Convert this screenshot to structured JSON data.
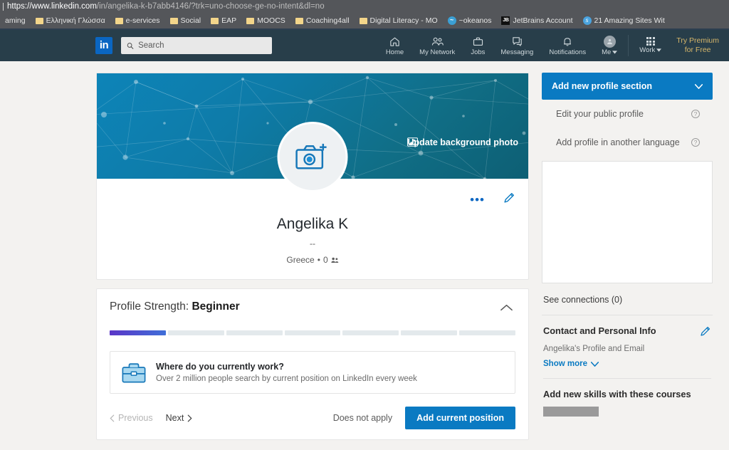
{
  "browser": {
    "url_strong": "https://www.linkedin.com",
    "url_dim": "/in/angelika-k-b7abb4146/?trk=uno-choose-ge-no-intent&dl=no",
    "bookmarks": [
      {
        "label": "aming",
        "icon": "none"
      },
      {
        "label": "Ελληνική Γλώσσα",
        "icon": "folder-icon"
      },
      {
        "label": "e-services",
        "icon": "folder-icon"
      },
      {
        "label": "Social",
        "icon": "folder-icon"
      },
      {
        "label": "EAP",
        "icon": "folder-icon"
      },
      {
        "label": "MOOCS",
        "icon": "folder-icon"
      },
      {
        "label": "Coaching4all",
        "icon": "folder-icon"
      },
      {
        "label": "Digital Literacy - MO",
        "icon": "folder-icon"
      },
      {
        "label": "~okeanos",
        "icon": "wave-icon"
      },
      {
        "label": "JetBrains Account",
        "icon": "jetbrains-icon"
      },
      {
        "label": "21 Amazing Sites Wit",
        "icon": "circle-icon"
      }
    ]
  },
  "nav": {
    "logo": "in",
    "search_placeholder": "Search",
    "items": [
      {
        "label": "Home",
        "icon": "home-icon"
      },
      {
        "label": "My Network",
        "icon": "people-icon"
      },
      {
        "label": "Jobs",
        "icon": "briefcase-icon"
      },
      {
        "label": "Messaging",
        "icon": "message-icon"
      },
      {
        "label": "Notifications",
        "icon": "bell-icon"
      }
    ],
    "me_label": "Me",
    "work_label": "Work",
    "premium_line1": "Try Premium",
    "premium_line2": "for Free"
  },
  "profile": {
    "update_background": "Update background photo",
    "name": "Angelika K",
    "headline": "--",
    "location": "Greece",
    "separator": "•",
    "connections": "0"
  },
  "strength": {
    "label": "Profile Strength:",
    "level": "Beginner",
    "segments_total": 7,
    "segments_filled": 1,
    "prompt_title": "Where do you currently work?",
    "prompt_sub": "Over 2 million people search by current position on LinkedIn every week",
    "previous": "Previous",
    "next": "Next",
    "does_not_apply": "Does not apply",
    "add_position": "Add current position"
  },
  "sidebar": {
    "add_section": "Add new profile section",
    "edit_public": "Edit your public profile",
    "add_language": "Add profile in another language",
    "see_connections": "See connections (0)",
    "contact_title": "Contact and Personal Info",
    "contact_sub": "Angelika's Profile and Email",
    "show_more": "Show more",
    "courses_title": "Add new skills with these courses"
  },
  "colors": {
    "linkedin_blue": "#0a66c2",
    "nav_bg": "#283e4a",
    "button_blue": "#0a7ac2",
    "premium_gold": "#d6b66a",
    "progress_start": "#5b36c7",
    "progress_end": "#3f6fd8"
  }
}
